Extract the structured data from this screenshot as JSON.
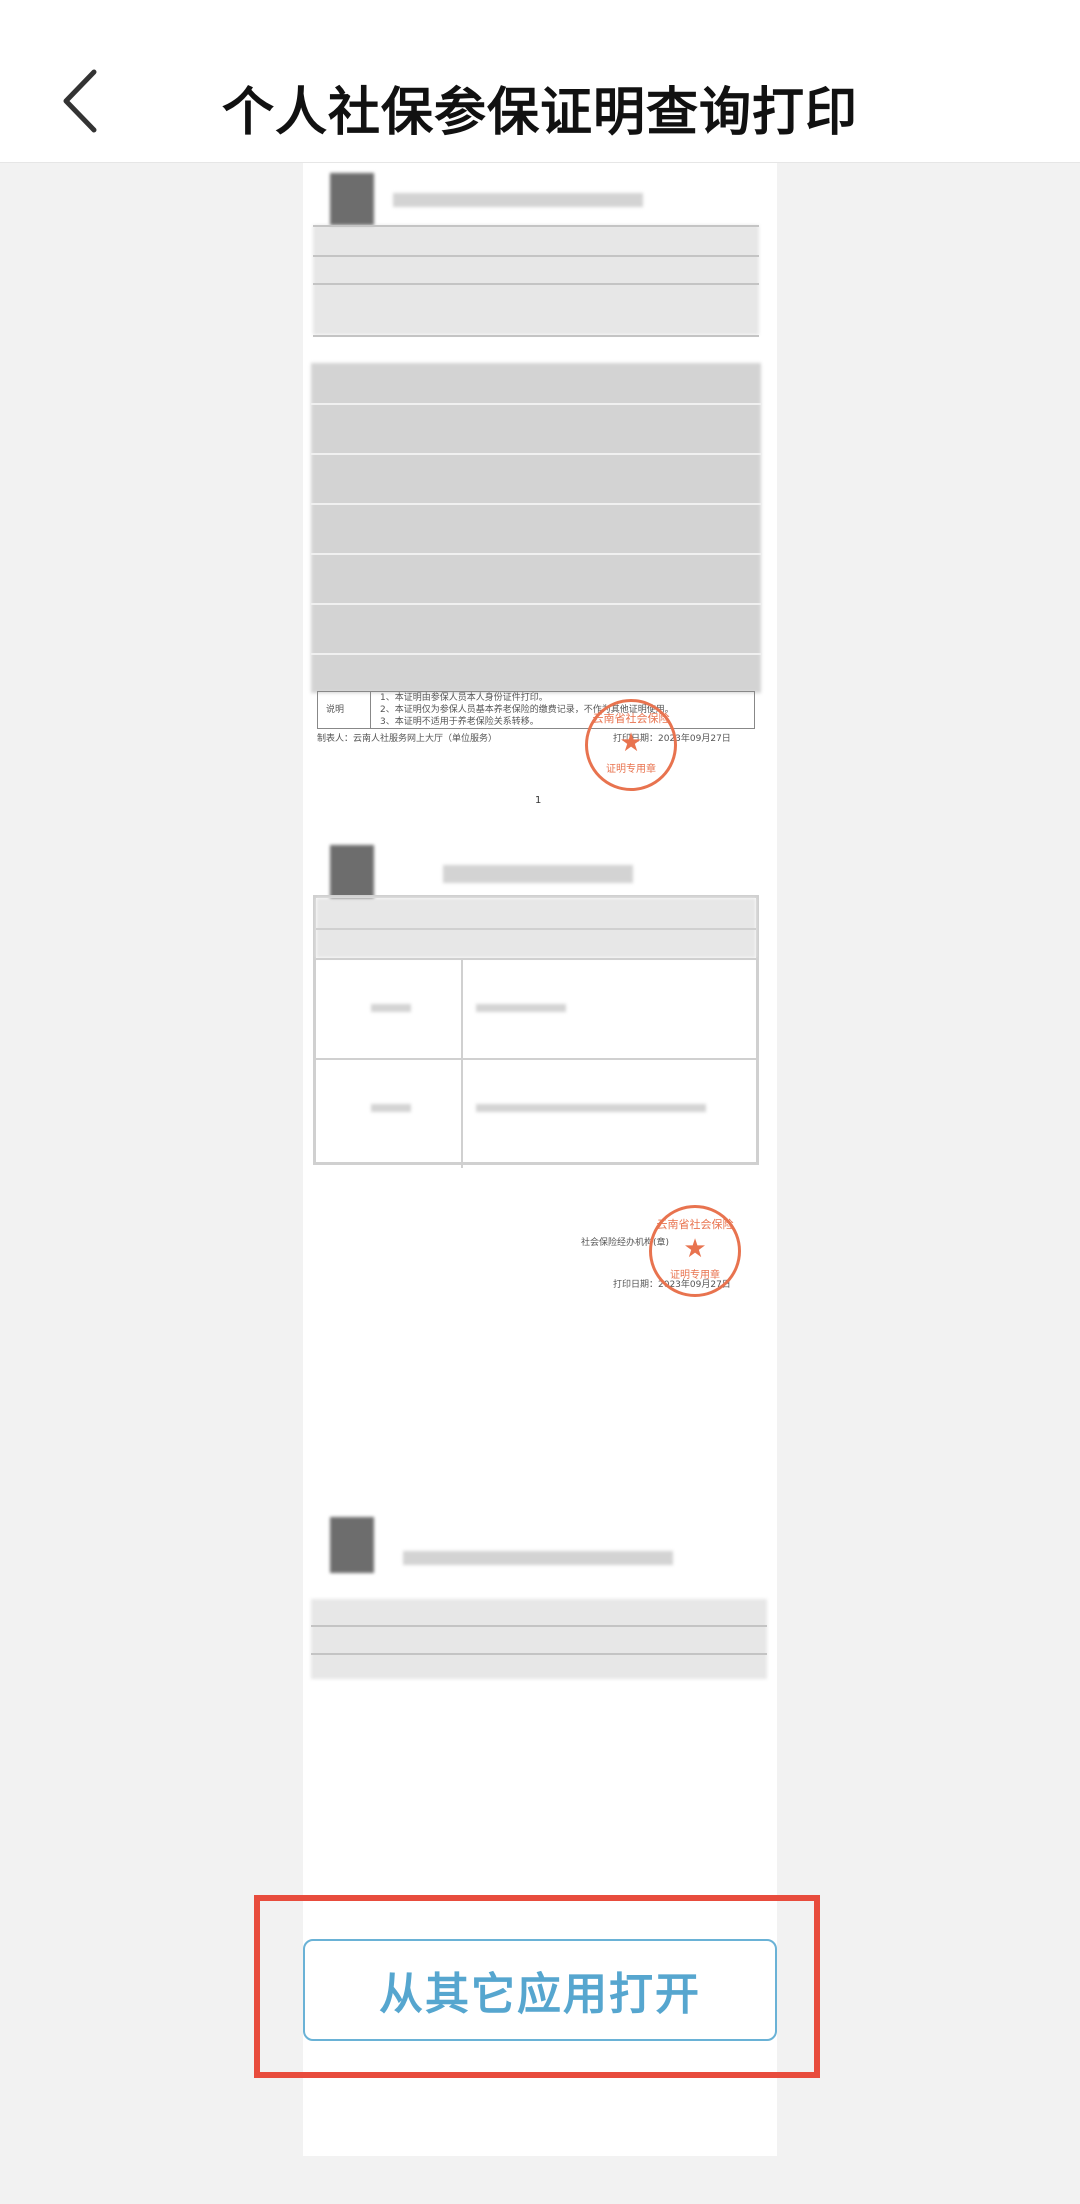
{
  "header": {
    "title": "个人社保参保证明查询打印",
    "back_icon": "chevron-left-icon"
  },
  "document": {
    "page1": {
      "notes_label": "说明",
      "notes": [
        "1、本证明由参保人员本人身份证件打印。",
        "2、本证明仅为参保人员基本养老保险的缴费记录，不作为其他证明使用。",
        "3、本证明不适用于养老保险关系转移。"
      ],
      "footer_left": "制表人：云南人社服务网上大厅（单位服务）",
      "footer_right": "打印日期：2023年09月27日",
      "page_number": "1",
      "stamp": {
        "ring_text": "云南省社会保险",
        "bottom_text": "证明专用章"
      }
    },
    "page2": {
      "stamp_label": "社会保险经办机构(章)",
      "print_date": "打印日期：2023年09月27日",
      "stamp": {
        "ring_text": "云南省社会保险",
        "bottom_text": "证明专用章"
      }
    }
  },
  "actions": {
    "open_other_app": "从其它应用打开"
  },
  "colors": {
    "highlight": "#e84c3d",
    "button_text": "#56a6cf",
    "stamp": "#e8734f"
  }
}
